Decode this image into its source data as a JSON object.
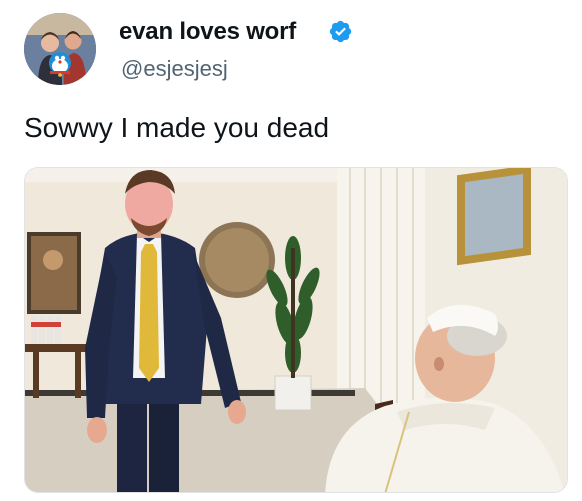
{
  "author": {
    "display_name": "evan loves worf",
    "handle": "@esjesjesj",
    "verified": true,
    "avatar_icon": "profile-photo-avatar",
    "verified_icon": "verified-badge-icon",
    "verified_color": "#1d9bf0"
  },
  "tweet": {
    "text": "Sowwy I made you dead"
  },
  "media": {
    "type": "photo",
    "icon": "attached-photo"
  },
  "colors": {
    "text_primary": "#0f1419",
    "text_secondary": "#536471",
    "background": "#ffffff"
  }
}
